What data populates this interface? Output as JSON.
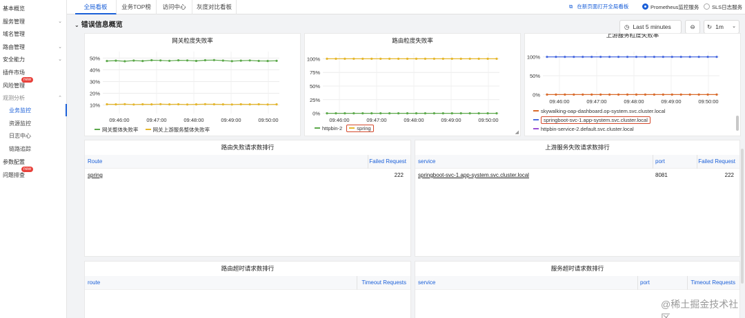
{
  "sidebar": {
    "items": [
      {
        "label": "基本概览",
        "top": 5
      },
      {
        "label": "服务管理",
        "top": 24,
        "chevron": true
      },
      {
        "label": "域名管理",
        "top": 42
      },
      {
        "label": "路由管理",
        "top": 61,
        "chevron": true
      },
      {
        "label": "安全能力",
        "top": 79,
        "chevron": true
      },
      {
        "label": "插件市场",
        "top": 98
      },
      {
        "label": "风险管理",
        "top": 117,
        "badge": "new"
      },
      {
        "label": "观测分析",
        "top": 135,
        "chevron": true,
        "expanded": true
      },
      {
        "label": "业务监控",
        "top": 153,
        "sub": true,
        "active": true
      },
      {
        "label": "资源监控",
        "top": 172,
        "sub": true
      },
      {
        "label": "日志中心",
        "top": 190,
        "sub": true
      },
      {
        "label": "链路追踪",
        "top": 209,
        "sub": true
      },
      {
        "label": "参数配置",
        "top": 228
      },
      {
        "label": "问题排查",
        "top": 247,
        "badge": "new"
      }
    ]
  },
  "tabs": [
    "全局看板",
    "业务TOP榜",
    "访问中心",
    "灰度对比看板"
  ],
  "topbar": {
    "open_new_page": "在新页面打开全局看板",
    "radio_prometheus": "Prometheus监控服务",
    "radio_sls": "SLS日志服务"
  },
  "section_title": "错误信息概览",
  "controls": {
    "time_range": "Last 5 minutes",
    "interval": "1m"
  },
  "colors": {
    "green": "#5ba84a",
    "yellow": "#e5b62b",
    "blue": "#4a6be0",
    "orange": "#d96a2b",
    "red": "#c9402a",
    "purple": "#9b4fd6",
    "accent": "#1a5fd8"
  },
  "chart_data": [
    {
      "type": "line",
      "title": "网关粒度失败率",
      "x_ticks": [
        "09:46:00",
        "09:47:00",
        "09:48:00",
        "09:49:00",
        "09:50:00"
      ],
      "y_ticks": [
        "50%",
        "40%",
        "30%",
        "20%",
        "10%"
      ],
      "ylim": [
        5,
        52
      ],
      "series": [
        {
          "name": "网关整体失败率",
          "color": "green",
          "values": [
            47.5,
            47.8,
            47.3,
            47.9,
            47.5,
            48.2,
            48.0,
            47.7,
            48.1,
            48.0,
            47.6,
            48.2,
            48.3,
            47.9,
            47.4,
            47.8,
            48.0,
            47.6,
            47.5,
            47.7
          ]
        },
        {
          "name": "网关上游服务整体失败率",
          "color": "yellow",
          "values": [
            10.6,
            10.5,
            10.7,
            10.4,
            10.6,
            10.5,
            10.7,
            10.5,
            10.6,
            10.4,
            10.5,
            10.7,
            10.6,
            10.5,
            10.4,
            10.6,
            10.5,
            10.6,
            10.4,
            10.5
          ]
        }
      ]
    },
    {
      "type": "line",
      "title": "路由粒度失败率",
      "x_ticks": [
        "09:46:00",
        "09:47:00",
        "09:48:00",
        "09:49:00",
        "09:50:00"
      ],
      "y_ticks": [
        "100%",
        "75%",
        "50%",
        "25%",
        "0%"
      ],
      "ylim": [
        -3,
        103
      ],
      "series": [
        {
          "name": "httpbin-2",
          "color": "green",
          "values": [
            0,
            0,
            0,
            0,
            0,
            0,
            0,
            0,
            0,
            0,
            0,
            0,
            0,
            0,
            0,
            0,
            0,
            0,
            0,
            0
          ]
        },
        {
          "name": "spring",
          "color": "yellow",
          "values": [
            100,
            100,
            100,
            100,
            100,
            100,
            100,
            100,
            100,
            100,
            100,
            100,
            100,
            100,
            100,
            100,
            100,
            100,
            100,
            100
          ]
        }
      ]
    },
    {
      "type": "line",
      "title": "上游服务粒度失败率",
      "x_ticks": [
        "09:46:00",
        "09:47:00",
        "09:48:00",
        "09:49:00",
        "09:50:00"
      ],
      "y_ticks": [
        "100%",
        "50%",
        "0%"
      ],
      "ylim": [
        -3,
        103
      ],
      "series": [
        {
          "name": "skywalking-oap-dashboard.op-system.svc.cluster.local",
          "color": "orange",
          "values": [
            0,
            0,
            0,
            0,
            0,
            0,
            0,
            0,
            0,
            0,
            0,
            0,
            0,
            0,
            0,
            0,
            0,
            0,
            0,
            0
          ]
        },
        {
          "name": "springboot-svc-1.app-system.svc.cluster.local",
          "color": "blue",
          "values": [
            100,
            100,
            100,
            100,
            100,
            100,
            100,
            100,
            100,
            100,
            100,
            100,
            100,
            100,
            100,
            100,
            100,
            100,
            100,
            100
          ]
        },
        {
          "name": "httpbin-service-2.default.svc.cluster.local",
          "color": "purple",
          "values": []
        }
      ]
    }
  ],
  "route_fail_table": {
    "title": "路由失败请求数排行",
    "columns": [
      "Route",
      "Failed Request"
    ],
    "rows": [
      {
        "route": "spring",
        "failed": "222"
      }
    ]
  },
  "upstream_fail_table": {
    "title": "上游服务失败请求数排行",
    "columns": [
      "service",
      "port",
      "Failed Request"
    ],
    "rows": [
      {
        "service": "springboot-svc-1.app-system.svc.cluster.local",
        "port": "8081",
        "failed": "222"
      }
    ]
  },
  "route_timeout_table": {
    "title": "路由超时请求数排行",
    "columns": [
      "route",
      "Timeout Requests"
    ]
  },
  "service_timeout_table": {
    "title": "服务超时请求数排行",
    "columns": [
      "service",
      "port",
      "Timeout Requests"
    ]
  },
  "watermark": "@稀土掘金技术社区"
}
